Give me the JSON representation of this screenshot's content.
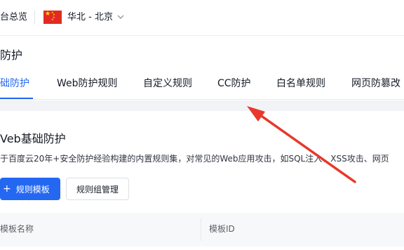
{
  "topbar": {
    "breadcrumb": "台总览",
    "region": "华北 - 北京"
  },
  "page": {
    "title": "防护"
  },
  "tabs": [
    {
      "label": "础防护",
      "active": true
    },
    {
      "label": "Web防护规则",
      "active": false
    },
    {
      "label": "自定义规则",
      "active": false
    },
    {
      "label": "CC防护",
      "active": false
    },
    {
      "label": "白名单规则",
      "active": false
    },
    {
      "label": "网页防篡改",
      "active": false
    }
  ],
  "card": {
    "title": "Veb基础防护",
    "description": "于百度云20年+安全防护经验构建的内置规则集，对常见的Web应用攻击，如SQL注入、XSS攻击、网页",
    "add_button": "规则模板",
    "manage_button": "规则组管理"
  },
  "table": {
    "columns": [
      "模板名称",
      "模板ID"
    ]
  },
  "colors": {
    "accent": "#2468f2",
    "annotation_arrow": "#e8382b",
    "flag_red": "#e22a24",
    "flag_star": "#ffde00"
  },
  "icons": [
    "china-flag-icon",
    "chevron-down-icon",
    "plus-icon",
    "annotation-arrow-icon"
  ]
}
